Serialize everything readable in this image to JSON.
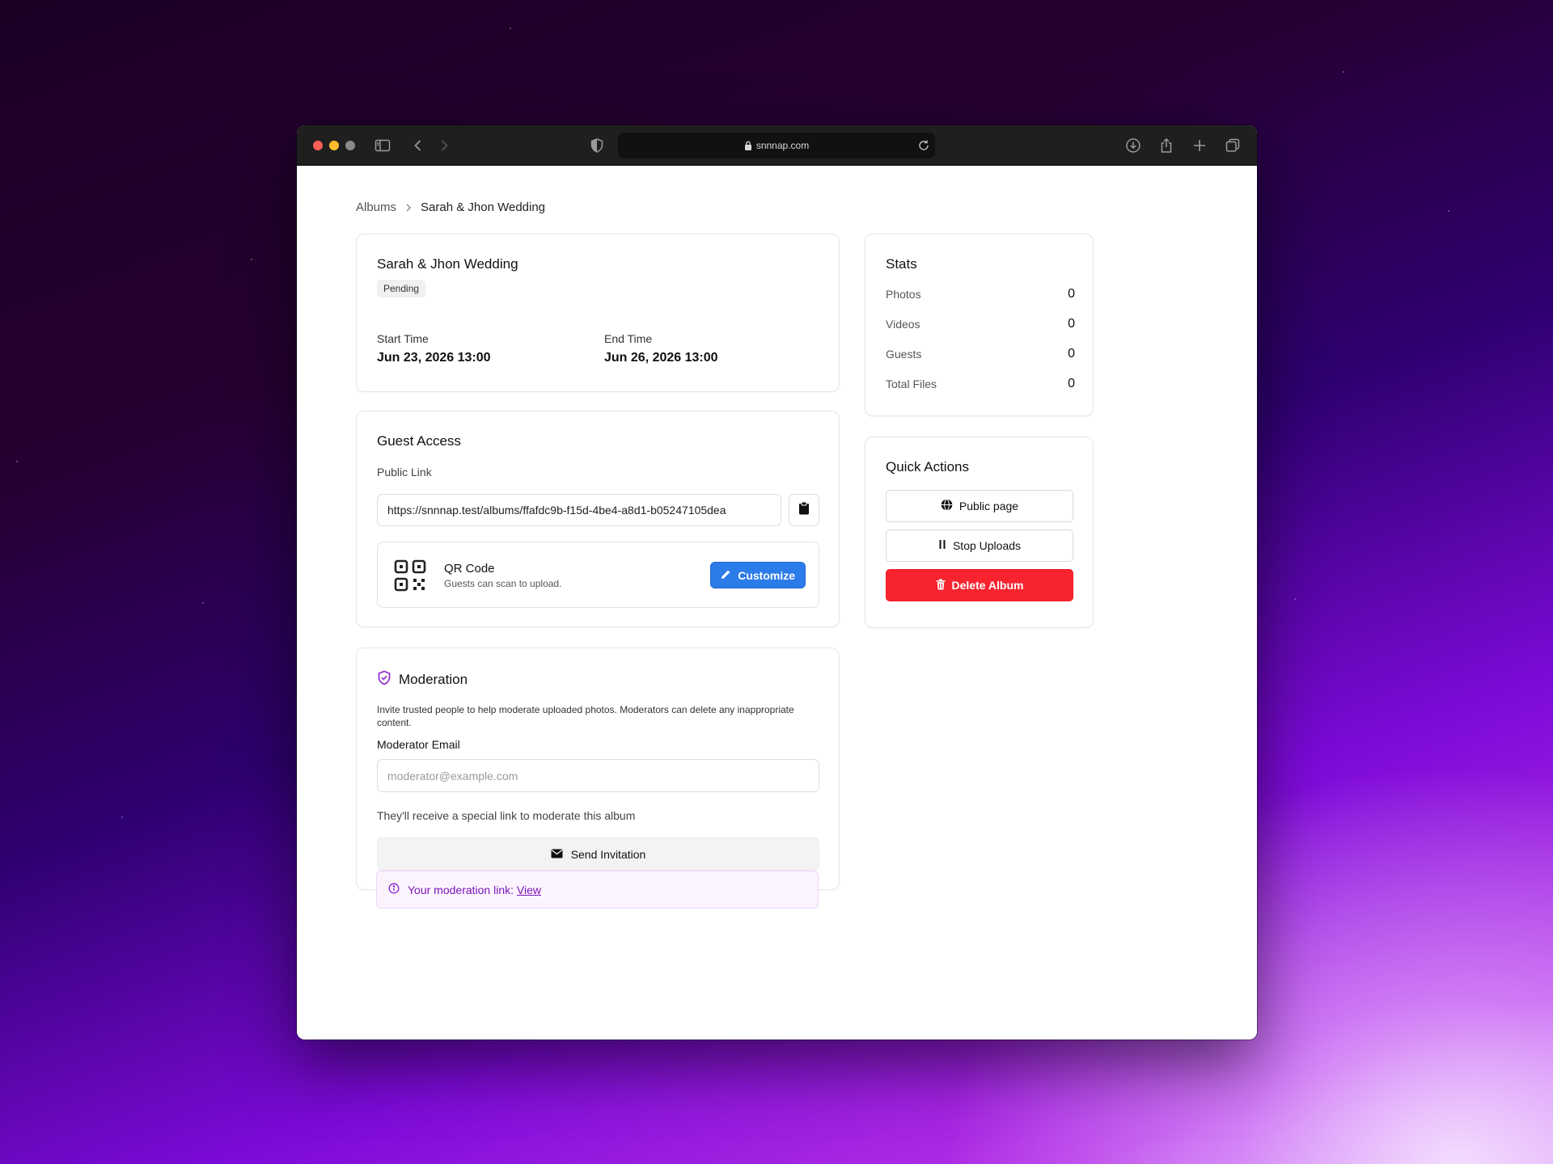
{
  "browser": {
    "url": "snnnap.com"
  },
  "breadcrumb": {
    "root": "Albums",
    "current": "Sarah & Jhon Wedding"
  },
  "album": {
    "title": "Sarah & Jhon Wedding",
    "status": "Pending",
    "start_label": "Start Time",
    "start_value": "Jun 23, 2026 13:00",
    "end_label": "End Time",
    "end_value": "Jun 26, 2026 13:00"
  },
  "guest_access": {
    "title": "Guest Access",
    "public_link_label": "Public Link",
    "public_link_value": "https://snnnap.test/albums/ffafdc9b-f15d-4be4-a8d1-b05247105dea",
    "qr_title": "QR Code",
    "qr_subtitle": "Guests can scan to upload.",
    "customize_label": "Customize"
  },
  "moderation": {
    "title": "Moderation",
    "description": "Invite trusted people to help moderate uploaded photos. Moderators can delete any inappropriate content.",
    "email_label": "Moderator Email",
    "email_placeholder": "moderator@example.com",
    "email_value": "",
    "help_text": "They'll receive a special link to moderate this album",
    "send_label": "Send Invitation",
    "notice_text": "Your moderation link:",
    "notice_link": "View",
    "accent_color": "#8a1fc9"
  },
  "stats": {
    "title": "Stats",
    "items": [
      {
        "label": "Photos",
        "value": "0"
      },
      {
        "label": "Videos",
        "value": "0"
      },
      {
        "label": "Guests",
        "value": "0"
      },
      {
        "label": "Total Files",
        "value": "0"
      }
    ]
  },
  "quick_actions": {
    "title": "Quick Actions",
    "public_page_label": "Public page",
    "stop_uploads_label": "Stop Uploads",
    "delete_label": "Delete Album",
    "danger_color": "#f7242f",
    "primary_color": "#2b7be9"
  }
}
